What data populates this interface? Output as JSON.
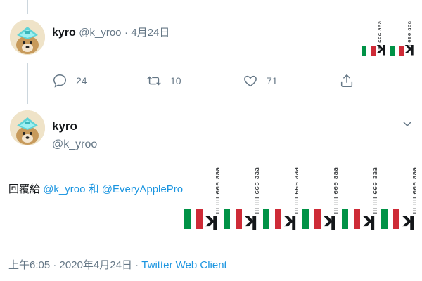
{
  "tweet1": {
    "name": "kyro",
    "handle": "@k_yroo",
    "separator": "·",
    "date": "4月24日",
    "actions": {
      "reply_count": "24",
      "retweet_count": "10",
      "like_count": "71"
    },
    "emoji_text": [
      "🇮🇹",
      "〰️⁻ʸ",
      "🇮🇹",
      "〰️⁻ʸ"
    ]
  },
  "tweet2": {
    "name": "kyro",
    "handle": "@k_yroo",
    "reply_prefix": "回覆給",
    "reply_user1": "@k_yroo",
    "reply_and": "和",
    "reply_user2": "@EveryApplePro",
    "time": "上午6:05",
    "date_sep": "·",
    "date": "2020年4月24日",
    "source_sep": "·",
    "source": "Twitter Web Client"
  },
  "icons": {
    "reply": "reply-bubble-icon",
    "retweet": "retweet-arrows-icon",
    "like": "heart-icon",
    "share": "share-upload-icon",
    "more": "chevron-down-icon"
  },
  "colors": {
    "link": "#1b95e0",
    "muted": "#657786",
    "text": "#14171a",
    "divider": "#e6ecf0"
  }
}
